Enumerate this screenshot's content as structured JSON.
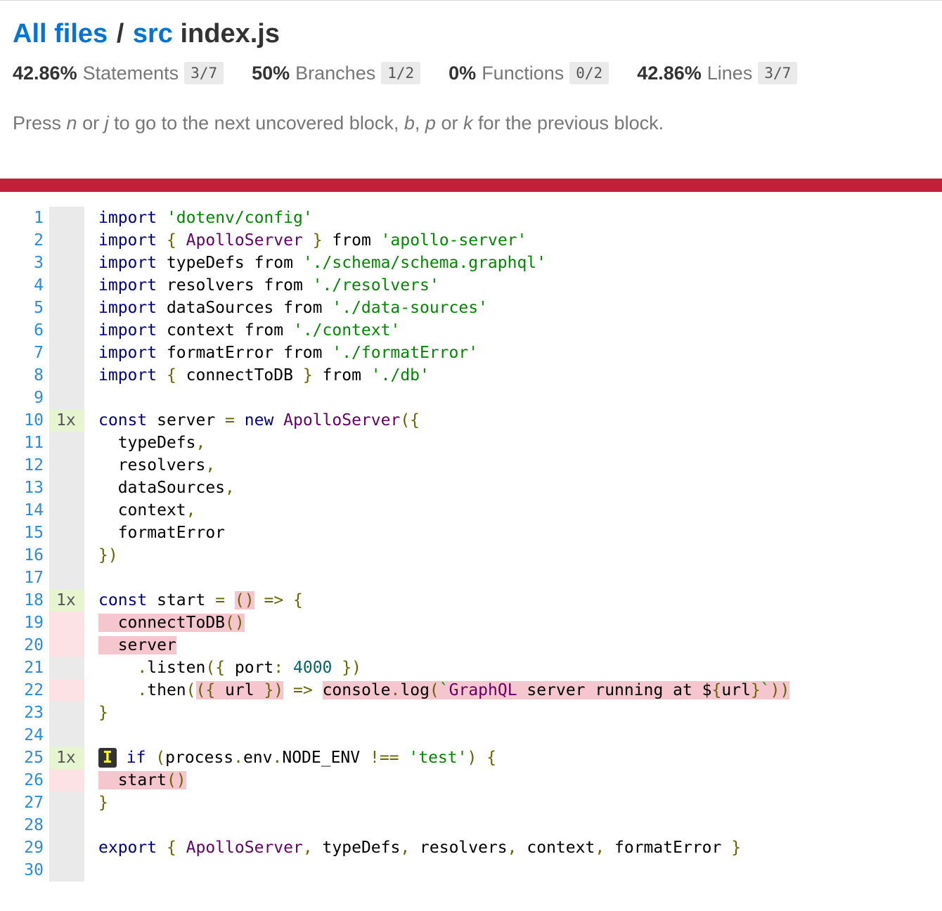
{
  "breadcrumb": {
    "all_files": "All files",
    "sep": "/",
    "dir": "src",
    "file": "index.js"
  },
  "stats": [
    {
      "pct": "42.86%",
      "label": "Statements",
      "frac": "3/7"
    },
    {
      "pct": "50%",
      "label": "Branches",
      "frac": "1/2"
    },
    {
      "pct": "0%",
      "label": "Functions",
      "frac": "0/2"
    },
    {
      "pct": "42.86%",
      "label": "Lines",
      "frac": "3/7"
    }
  ],
  "hint": {
    "t1": "Press ",
    "k1": "n",
    "t2": " or ",
    "k2": "j",
    "t3": " to go to the next uncovered block, ",
    "k3": "b",
    "t4": ", ",
    "k4": "p",
    "t5": " or ",
    "k5": "k",
    "t6": " for the previous block."
  },
  "colors": {
    "red_bar": "#c21f39",
    "link": "#0074d9",
    "hit": "#e6f5d0",
    "miss": "#fce1e5"
  },
  "lines": [
    {
      "n": "1",
      "count": "",
      "status": "neutral",
      "tokens": [
        [
          "kw",
          "import"
        ],
        [
          "pln",
          " "
        ],
        [
          "str",
          "'dotenv/config'"
        ]
      ]
    },
    {
      "n": "2",
      "count": "",
      "status": "neutral",
      "tokens": [
        [
          "kw",
          "import"
        ],
        [
          "pln",
          " "
        ],
        [
          "pun",
          "{"
        ],
        [
          "pln",
          " "
        ],
        [
          "typ",
          "ApolloServer"
        ],
        [
          "pln",
          " "
        ],
        [
          "pun",
          "}"
        ],
        [
          "pln",
          " from "
        ],
        [
          "str",
          "'apollo-server'"
        ]
      ]
    },
    {
      "n": "3",
      "count": "",
      "status": "neutral",
      "tokens": [
        [
          "kw",
          "import"
        ],
        [
          "pln",
          " typeDefs from "
        ],
        [
          "str",
          "'./schema/schema.graphql'"
        ]
      ]
    },
    {
      "n": "4",
      "count": "",
      "status": "neutral",
      "tokens": [
        [
          "kw",
          "import"
        ],
        [
          "pln",
          " resolvers from "
        ],
        [
          "str",
          "'./resolvers'"
        ]
      ]
    },
    {
      "n": "5",
      "count": "",
      "status": "neutral",
      "tokens": [
        [
          "kw",
          "import"
        ],
        [
          "pln",
          " dataSources from "
        ],
        [
          "str",
          "'./data-sources'"
        ]
      ]
    },
    {
      "n": "6",
      "count": "",
      "status": "neutral",
      "tokens": [
        [
          "kw",
          "import"
        ],
        [
          "pln",
          " context from "
        ],
        [
          "str",
          "'./context'"
        ]
      ]
    },
    {
      "n": "7",
      "count": "",
      "status": "neutral",
      "tokens": [
        [
          "kw",
          "import"
        ],
        [
          "pln",
          " formatError from "
        ],
        [
          "str",
          "'./formatError'"
        ]
      ]
    },
    {
      "n": "8",
      "count": "",
      "status": "neutral",
      "tokens": [
        [
          "kw",
          "import"
        ],
        [
          "pln",
          " "
        ],
        [
          "pun",
          "{"
        ],
        [
          "pln",
          " connectToDB "
        ],
        [
          "pun",
          "}"
        ],
        [
          "pln",
          " from "
        ],
        [
          "str",
          "'./db'"
        ]
      ]
    },
    {
      "n": "9",
      "count": "",
      "status": "neutral",
      "tokens": []
    },
    {
      "n": "10",
      "count": "1x",
      "status": "hit",
      "tokens": [
        [
          "kw",
          "const"
        ],
        [
          "pln",
          " server "
        ],
        [
          "pun",
          "="
        ],
        [
          "pln",
          " "
        ],
        [
          "kw",
          "new"
        ],
        [
          "pln",
          " "
        ],
        [
          "typ",
          "ApolloServer"
        ],
        [
          "pun",
          "({"
        ]
      ]
    },
    {
      "n": "11",
      "count": "",
      "status": "neutral",
      "tokens": [
        [
          "pln",
          "  typeDefs"
        ],
        [
          "pun",
          ","
        ]
      ]
    },
    {
      "n": "12",
      "count": "",
      "status": "neutral",
      "tokens": [
        [
          "pln",
          "  resolvers"
        ],
        [
          "pun",
          ","
        ]
      ]
    },
    {
      "n": "13",
      "count": "",
      "status": "neutral",
      "tokens": [
        [
          "pln",
          "  dataSources"
        ],
        [
          "pun",
          ","
        ]
      ]
    },
    {
      "n": "14",
      "count": "",
      "status": "neutral",
      "tokens": [
        [
          "pln",
          "  context"
        ],
        [
          "pun",
          ","
        ]
      ]
    },
    {
      "n": "15",
      "count": "",
      "status": "neutral",
      "tokens": [
        [
          "pln",
          "  formatError"
        ]
      ]
    },
    {
      "n": "16",
      "count": "",
      "status": "neutral",
      "tokens": [
        [
          "pun",
          "})"
        ]
      ]
    },
    {
      "n": "17",
      "count": "",
      "status": "neutral",
      "tokens": []
    },
    {
      "n": "18",
      "count": "1x",
      "status": "hit",
      "tokens": [
        [
          "kw",
          "const"
        ],
        [
          "pln",
          " start "
        ],
        [
          "pun",
          "="
        ],
        [
          "pln",
          " "
        ],
        [
          "pun nc",
          "()"
        ],
        [
          "pln",
          " "
        ],
        [
          "pun",
          "=>"
        ],
        [
          "pln",
          " "
        ],
        [
          "pun",
          "{"
        ]
      ]
    },
    {
      "n": "19",
      "count": "",
      "status": "miss",
      "tokens": [
        [
          "pln nc",
          "  connectToDB"
        ],
        [
          "pun nc",
          "()"
        ]
      ]
    },
    {
      "n": "20",
      "count": "",
      "status": "miss",
      "tokens": [
        [
          "pln nc",
          "  server"
        ]
      ]
    },
    {
      "n": "21",
      "count": "",
      "status": "neutral",
      "tokens": [
        [
          "pln",
          "    "
        ],
        [
          "pun",
          "."
        ],
        [
          "pln",
          "listen"
        ],
        [
          "pun",
          "({"
        ],
        [
          "pln",
          " port"
        ],
        [
          "pun",
          ":"
        ],
        [
          "pln",
          " "
        ],
        [
          "lit",
          "4000"
        ],
        [
          "pln",
          " "
        ],
        [
          "pun",
          "})"
        ]
      ]
    },
    {
      "n": "22",
      "count": "",
      "status": "miss",
      "tokens": [
        [
          "pln",
          "    "
        ],
        [
          "pun",
          "."
        ],
        [
          "pln",
          "then"
        ],
        [
          "pun",
          "("
        ],
        [
          "pun nc",
          "({"
        ],
        [
          "pln nc",
          " url "
        ],
        [
          "pun nc",
          "})"
        ],
        [
          "pln",
          " "
        ],
        [
          "pun",
          "=>"
        ],
        [
          "pln",
          " "
        ],
        [
          "pln nc",
          "console"
        ],
        [
          "pun nc",
          "."
        ],
        [
          "pln nc",
          "log"
        ],
        [
          "pun nc",
          "("
        ],
        [
          "str nc",
          "`"
        ],
        [
          "typ nc",
          "GraphQL"
        ],
        [
          "pln nc",
          " server running at $"
        ],
        [
          "pun nc",
          "{"
        ],
        [
          "pln nc",
          "url"
        ],
        [
          "pun nc",
          "}"
        ],
        [
          "str nc",
          "`"
        ],
        [
          "pun nc",
          "))"
        ]
      ]
    },
    {
      "n": "23",
      "count": "",
      "status": "neutral",
      "tokens": [
        [
          "pun",
          "}"
        ]
      ]
    },
    {
      "n": "24",
      "count": "",
      "status": "neutral",
      "tokens": []
    },
    {
      "n": "25",
      "count": "1x",
      "status": "hit",
      "badge": "I",
      "tokens": [
        [
          "pln",
          " "
        ],
        [
          "kw",
          "if"
        ],
        [
          "pln",
          " "
        ],
        [
          "pun",
          "("
        ],
        [
          "pln",
          "process"
        ],
        [
          "pun",
          "."
        ],
        [
          "pln",
          "env"
        ],
        [
          "pun",
          "."
        ],
        [
          "pln",
          "NODE_ENV "
        ],
        [
          "pun",
          "!=="
        ],
        [
          "pln",
          " "
        ],
        [
          "str",
          "'test'"
        ],
        [
          "pun",
          ")"
        ],
        [
          "pln",
          " "
        ],
        [
          "pun",
          "{"
        ]
      ]
    },
    {
      "n": "26",
      "count": "",
      "status": "miss",
      "tokens": [
        [
          "pln nc",
          "  start"
        ],
        [
          "pun nc",
          "()"
        ]
      ]
    },
    {
      "n": "27",
      "count": "",
      "status": "neutral",
      "tokens": [
        [
          "pun",
          "}"
        ]
      ]
    },
    {
      "n": "28",
      "count": "",
      "status": "neutral",
      "tokens": []
    },
    {
      "n": "29",
      "count": "",
      "status": "neutral",
      "tokens": [
        [
          "kw",
          "export"
        ],
        [
          "pln",
          " "
        ],
        [
          "pun",
          "{"
        ],
        [
          "pln",
          " "
        ],
        [
          "typ",
          "ApolloServer"
        ],
        [
          "pun",
          ","
        ],
        [
          "pln",
          " typeDefs"
        ],
        [
          "pun",
          ","
        ],
        [
          "pln",
          " resolvers"
        ],
        [
          "pun",
          ","
        ],
        [
          "pln",
          " context"
        ],
        [
          "pun",
          ","
        ],
        [
          "pln",
          " formatError "
        ],
        [
          "pun",
          "}"
        ]
      ]
    },
    {
      "n": "30",
      "count": "",
      "status": "neutral",
      "tokens": []
    }
  ]
}
